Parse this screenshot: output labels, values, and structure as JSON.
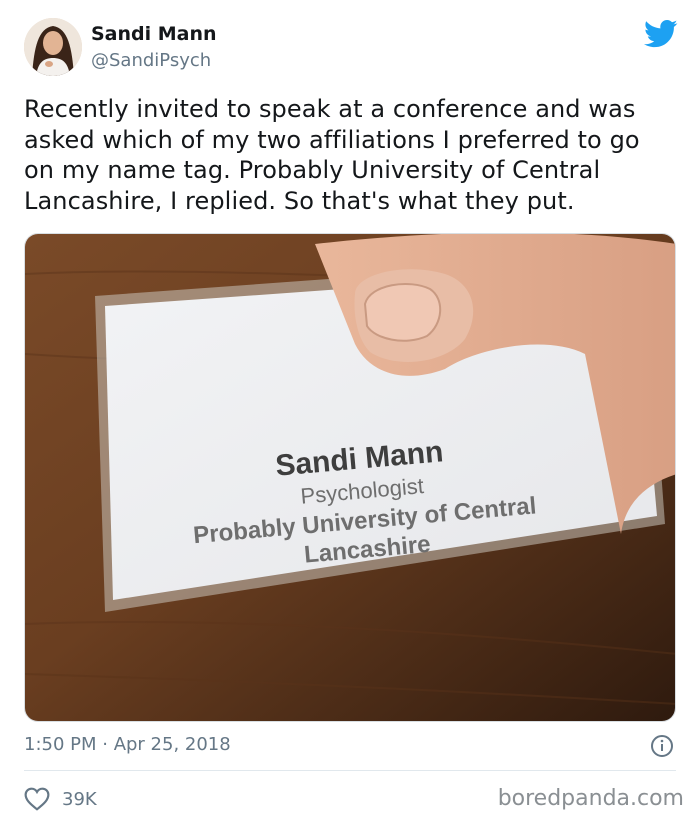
{
  "author": {
    "name": "Sandi Mann",
    "handle": "@SandiPsych"
  },
  "tweet": {
    "lines": [
      "Recently invited to speak at a conference and was",
      "asked which of my two affiliations I preferred to go",
      "on my name tag. Probably University of Central",
      "Lancashire, I replied. So that's what they put."
    ],
    "timestamp": "1:50 PM · Apr 25, 2018",
    "likes": "39K"
  },
  "photo": {
    "badge_name": "Sandi Mann",
    "badge_title": "Psychologist",
    "badge_affiliation_line1": "Probably University of Central",
    "badge_affiliation_line2": "Lancashire"
  },
  "watermark": "boredpanda.com",
  "colors": {
    "twitter_blue": "#1da1f2",
    "secondary_text": "#657786"
  },
  "icons": {
    "brand": "twitter-bird-icon",
    "info": "info-icon",
    "like": "heart-icon"
  }
}
